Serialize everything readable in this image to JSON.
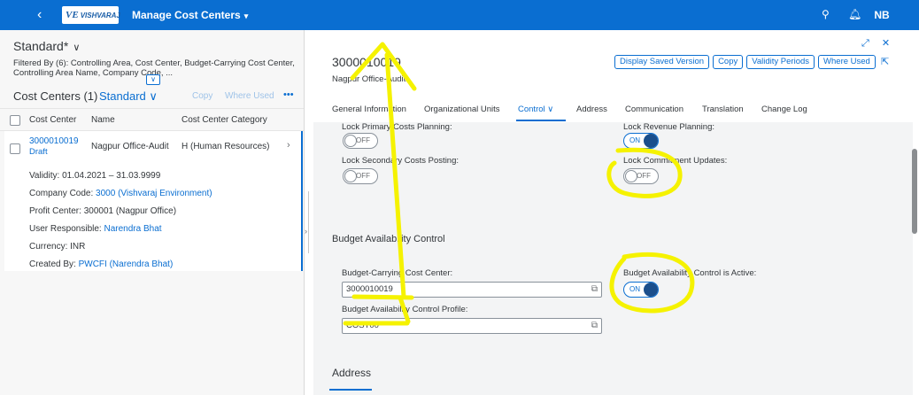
{
  "shell": {
    "back_icon": "back-icon",
    "logo_mark": "VE",
    "logo_word": "VISHVARAJ",
    "title": "Manage Cost Centers",
    "avatar": "NB"
  },
  "left": {
    "variant": "Standard*",
    "filter_info": "Filtered By (6): Controlling Area, Cost Center, Budget-Carrying Cost Center, Controlling Area Name, Company Code, ...",
    "list_title": "Cost Centers (1)",
    "list_variant": "Standard",
    "copy": "Copy",
    "where_used": "Where Used",
    "more": "•••",
    "columns": [
      "Cost Center",
      "Name",
      "Cost Center Category"
    ],
    "row": {
      "id": "3000010019",
      "status": "Draft",
      "name": "Nagpur Office-Audit",
      "category": "H (Human Resources)",
      "details": [
        {
          "label": "Validity:",
          "value": "01.04.2021 – 31.03.9999",
          "link": false
        },
        {
          "label": "Company Code:",
          "value": "3000 (Vishvaraj Environment)",
          "link": true
        },
        {
          "label": "Profit Center:",
          "value": "300001 (Nagpur Office)",
          "link": false
        },
        {
          "label": "User Responsible:",
          "value": "Narendra Bhat",
          "link": true
        },
        {
          "label": "Currency:",
          "value": "INR",
          "link": false
        },
        {
          "label": "Created By:",
          "value": "PWCFI (Narendra Bhat)",
          "link": true
        }
      ]
    }
  },
  "right": {
    "title": "3000010019",
    "subtitle": "Nagpur Office-Audit",
    "buttons": [
      "Display Saved Version",
      "Copy",
      "Validity Periods",
      "Where Used"
    ],
    "tabs": [
      "General Information",
      "Organizational Units",
      "Control",
      "Address",
      "Communication",
      "Translation",
      "Change Log"
    ],
    "active_tab": "Control",
    "fields": {
      "lock_primary": "Lock Primary Costs Planning:",
      "lock_revenue": "Lock Revenue Planning:",
      "lock_secondary": "Lock Secondary Costs Posting:",
      "lock_commitment": "Lock Commitment Updates:",
      "section": "Budget Availability Control",
      "budget_cc_label": "Budget-Carrying Cost Center:",
      "budget_cc_value": "3000010019",
      "bac_active_label": "Budget Availability Control is Active:",
      "bac_profile_label": "Budget Availability Control Profile:",
      "bac_profile_value": "COST00"
    },
    "toggles": {
      "off": "OFF",
      "on": "ON"
    },
    "address_section": "Address"
  },
  "colors": {
    "shell": "#0a6ed1",
    "annotation": "#f5f200"
  }
}
